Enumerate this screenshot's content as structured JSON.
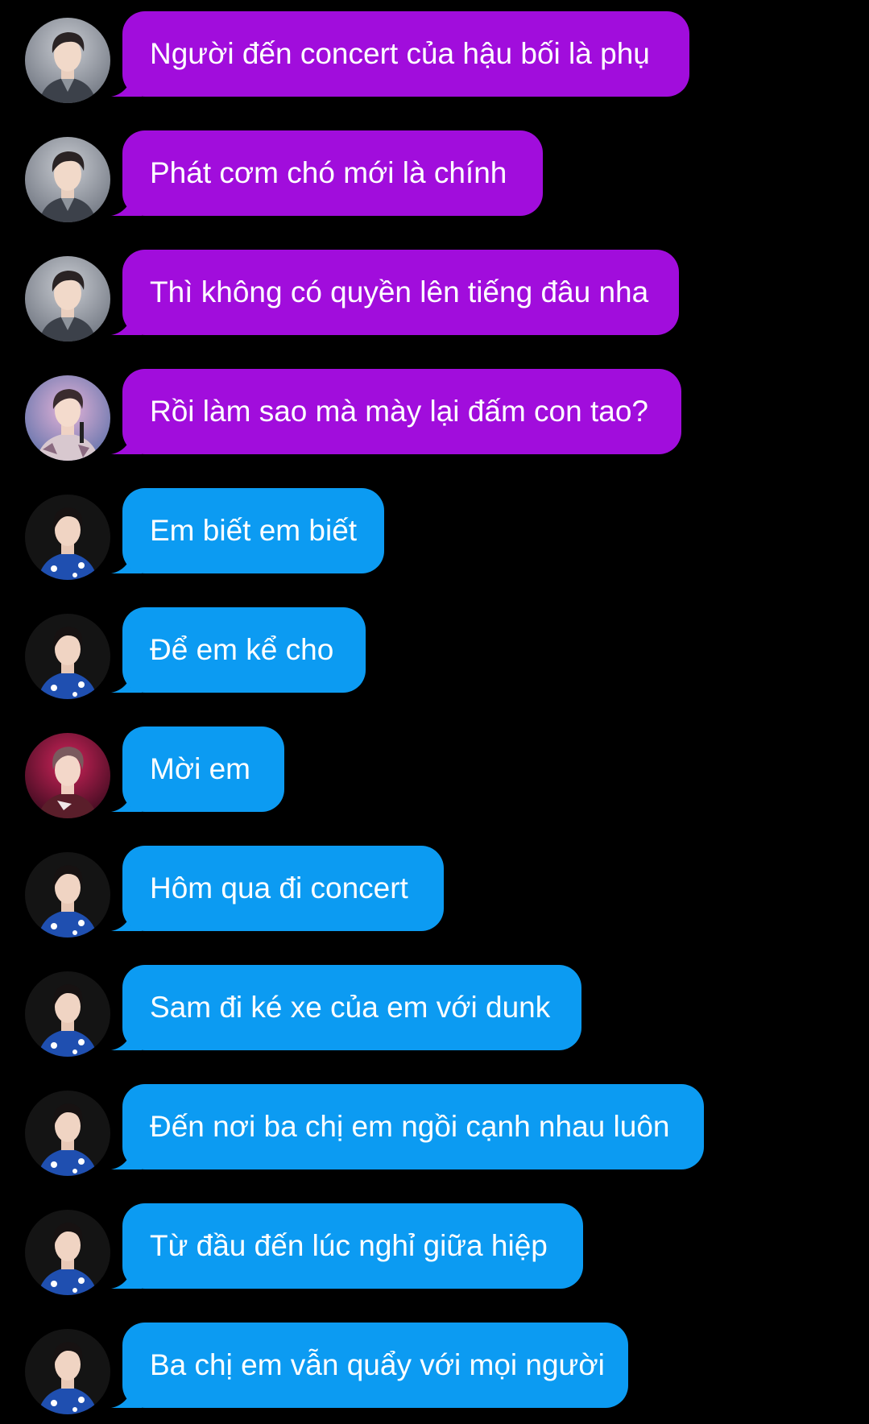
{
  "colors": {
    "background": "#000000",
    "purple_bubble": "#a10ddc",
    "blue_bubble": "#0c9bf2",
    "text": "#ffffff"
  },
  "messages": [
    {
      "text": "Người đến concert của hậu bối là phụ",
      "color": "purple",
      "avatar": "avatar-gray-jacket"
    },
    {
      "text": "Phát cơm chó mới là chính",
      "color": "purple",
      "avatar": "avatar-gray-jacket"
    },
    {
      "text": "Thì không có quyền lên tiếng đâu nha",
      "color": "purple",
      "avatar": "avatar-gray-jacket"
    },
    {
      "text": "Rồi làm sao mà mày lại đấm con tao?",
      "color": "purple",
      "avatar": "avatar-stage-pink"
    },
    {
      "text": "Em biết em biết",
      "color": "blue",
      "avatar": "avatar-dark-blue-shirt"
    },
    {
      "text": "Để em kể cho",
      "color": "blue",
      "avatar": "avatar-dark-blue-shirt"
    },
    {
      "text": "Mời em",
      "color": "blue",
      "avatar": "avatar-stage-red"
    },
    {
      "text": "Hôm qua đi concert",
      "color": "blue",
      "avatar": "avatar-dark-blue-shirt"
    },
    {
      "text": "Sam đi ké xe của em với dunk",
      "color": "blue",
      "avatar": "avatar-dark-blue-shirt"
    },
    {
      "text": "Đến nơi ba chị em ngồi cạnh nhau luôn",
      "color": "blue",
      "avatar": "avatar-dark-blue-shirt"
    },
    {
      "text": "Từ đầu đến lúc nghỉ giữa hiệp",
      "color": "blue",
      "avatar": "avatar-dark-blue-shirt"
    },
    {
      "text": "Ba chị em vẫn quẩy với mọi người",
      "color": "blue",
      "avatar": "avatar-dark-blue-shirt"
    }
  ]
}
